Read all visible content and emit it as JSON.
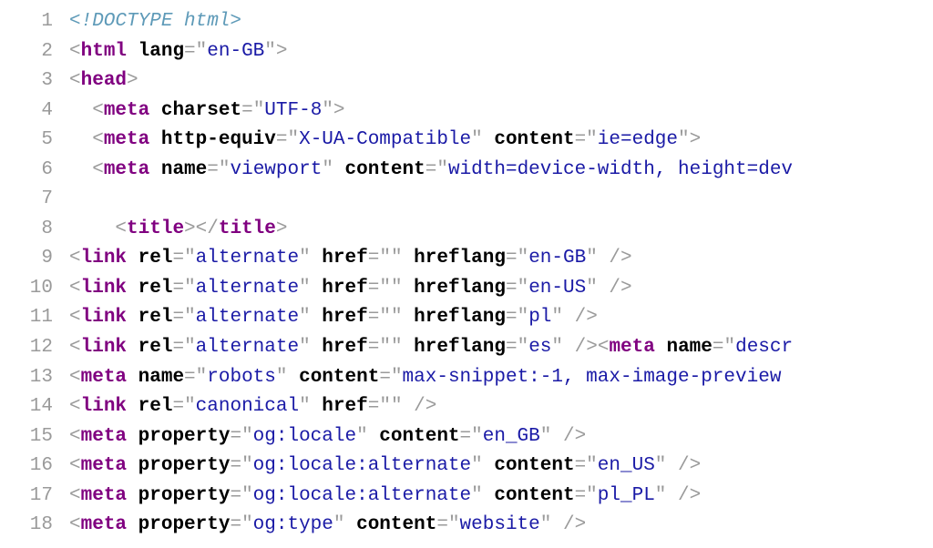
{
  "lines": [
    {
      "n": 1,
      "tokens": [
        [
          "doctype",
          "<!DOCTYPE html>"
        ]
      ]
    },
    {
      "n": 2,
      "tokens": [
        [
          "punct",
          "<"
        ],
        [
          "tag",
          "html"
        ],
        [
          "attr",
          " lang"
        ],
        [
          "punct",
          "="
        ],
        [
          "punct",
          "\""
        ],
        [
          "val",
          "en-GB"
        ],
        [
          "punct",
          "\""
        ],
        [
          "punct",
          ">"
        ]
      ]
    },
    {
      "n": 3,
      "tokens": [
        [
          "punct",
          "<"
        ],
        [
          "tag",
          "head"
        ],
        [
          "punct",
          ">"
        ]
      ]
    },
    {
      "n": 4,
      "tokens": [
        [
          "plain",
          "  "
        ],
        [
          "punct",
          "<"
        ],
        [
          "tag",
          "meta"
        ],
        [
          "attr",
          " charset"
        ],
        [
          "punct",
          "="
        ],
        [
          "punct",
          "\""
        ],
        [
          "val",
          "UTF-8"
        ],
        [
          "punct",
          "\""
        ],
        [
          "punct",
          ">"
        ]
      ]
    },
    {
      "n": 5,
      "tokens": [
        [
          "plain",
          "  "
        ],
        [
          "punct",
          "<"
        ],
        [
          "tag",
          "meta"
        ],
        [
          "attr",
          " http-equiv"
        ],
        [
          "punct",
          "="
        ],
        [
          "punct",
          "\""
        ],
        [
          "val",
          "X-UA-Compatible"
        ],
        [
          "punct",
          "\""
        ],
        [
          "attr",
          " content"
        ],
        [
          "punct",
          "="
        ],
        [
          "punct",
          "\""
        ],
        [
          "val",
          "ie=edge"
        ],
        [
          "punct",
          "\""
        ],
        [
          "punct",
          ">"
        ]
      ]
    },
    {
      "n": 6,
      "tokens": [
        [
          "plain",
          "  "
        ],
        [
          "punct",
          "<"
        ],
        [
          "tag",
          "meta"
        ],
        [
          "attr",
          " name"
        ],
        [
          "punct",
          "="
        ],
        [
          "punct",
          "\""
        ],
        [
          "val",
          "viewport"
        ],
        [
          "punct",
          "\""
        ],
        [
          "attr",
          " content"
        ],
        [
          "punct",
          "="
        ],
        [
          "punct",
          "\""
        ],
        [
          "val",
          "width=device-width, height=dev"
        ]
      ]
    },
    {
      "n": 7,
      "tokens": [
        [
          "plain",
          ""
        ]
      ]
    },
    {
      "n": 8,
      "tokens": [
        [
          "plain",
          "    "
        ],
        [
          "punct",
          "<"
        ],
        [
          "tag",
          "title"
        ],
        [
          "punct",
          ">"
        ],
        [
          "punct",
          "</"
        ],
        [
          "tag",
          "title"
        ],
        [
          "punct",
          ">"
        ]
      ]
    },
    {
      "n": 9,
      "tokens": [
        [
          "punct",
          "<"
        ],
        [
          "tag",
          "link"
        ],
        [
          "attr",
          " rel"
        ],
        [
          "punct",
          "="
        ],
        [
          "punct",
          "\""
        ],
        [
          "val",
          "alternate"
        ],
        [
          "punct",
          "\""
        ],
        [
          "attr",
          " href"
        ],
        [
          "punct",
          "="
        ],
        [
          "punct",
          "\""
        ],
        [
          "punct",
          "\""
        ],
        [
          "attr",
          " hreflang"
        ],
        [
          "punct",
          "="
        ],
        [
          "punct",
          "\""
        ],
        [
          "val",
          "en-GB"
        ],
        [
          "punct",
          "\""
        ],
        [
          "punct",
          " />"
        ]
      ]
    },
    {
      "n": 10,
      "tokens": [
        [
          "punct",
          "<"
        ],
        [
          "tag",
          "link"
        ],
        [
          "attr",
          " rel"
        ],
        [
          "punct",
          "="
        ],
        [
          "punct",
          "\""
        ],
        [
          "val",
          "alternate"
        ],
        [
          "punct",
          "\""
        ],
        [
          "attr",
          " href"
        ],
        [
          "punct",
          "="
        ],
        [
          "punct",
          "\""
        ],
        [
          "punct",
          "\""
        ],
        [
          "attr",
          " hreflang"
        ],
        [
          "punct",
          "="
        ],
        [
          "punct",
          "\""
        ],
        [
          "val",
          "en-US"
        ],
        [
          "punct",
          "\""
        ],
        [
          "punct",
          " />"
        ]
      ]
    },
    {
      "n": 11,
      "tokens": [
        [
          "punct",
          "<"
        ],
        [
          "tag",
          "link"
        ],
        [
          "attr",
          " rel"
        ],
        [
          "punct",
          "="
        ],
        [
          "punct",
          "\""
        ],
        [
          "val",
          "alternate"
        ],
        [
          "punct",
          "\""
        ],
        [
          "attr",
          " href"
        ],
        [
          "punct",
          "="
        ],
        [
          "punct",
          "\""
        ],
        [
          "punct",
          "\""
        ],
        [
          "attr",
          " hreflang"
        ],
        [
          "punct",
          "="
        ],
        [
          "punct",
          "\""
        ],
        [
          "val",
          "pl"
        ],
        [
          "punct",
          "\""
        ],
        [
          "punct",
          " />"
        ]
      ]
    },
    {
      "n": 12,
      "tokens": [
        [
          "punct",
          "<"
        ],
        [
          "tag",
          "link"
        ],
        [
          "attr",
          " rel"
        ],
        [
          "punct",
          "="
        ],
        [
          "punct",
          "\""
        ],
        [
          "val",
          "alternate"
        ],
        [
          "punct",
          "\""
        ],
        [
          "attr",
          " href"
        ],
        [
          "punct",
          "="
        ],
        [
          "punct",
          "\""
        ],
        [
          "punct",
          "\""
        ],
        [
          "attr",
          " hreflang"
        ],
        [
          "punct",
          "="
        ],
        [
          "punct",
          "\""
        ],
        [
          "val",
          "es"
        ],
        [
          "punct",
          "\""
        ],
        [
          "punct",
          " />"
        ],
        [
          "punct",
          "<"
        ],
        [
          "tag",
          "meta"
        ],
        [
          "attr",
          " name"
        ],
        [
          "punct",
          "="
        ],
        [
          "punct",
          "\""
        ],
        [
          "val",
          "descr"
        ]
      ]
    },
    {
      "n": 13,
      "tokens": [
        [
          "punct",
          "<"
        ],
        [
          "tag",
          "meta"
        ],
        [
          "attr",
          " name"
        ],
        [
          "punct",
          "="
        ],
        [
          "punct",
          "\""
        ],
        [
          "val",
          "robots"
        ],
        [
          "punct",
          "\""
        ],
        [
          "attr",
          " content"
        ],
        [
          "punct",
          "="
        ],
        [
          "punct",
          "\""
        ],
        [
          "val",
          "max-snippet:-1, max-image-preview"
        ]
      ]
    },
    {
      "n": 14,
      "tokens": [
        [
          "punct",
          "<"
        ],
        [
          "tag",
          "link"
        ],
        [
          "attr",
          " rel"
        ],
        [
          "punct",
          "="
        ],
        [
          "punct",
          "\""
        ],
        [
          "val",
          "canonical"
        ],
        [
          "punct",
          "\""
        ],
        [
          "attr",
          " href"
        ],
        [
          "punct",
          "="
        ],
        [
          "punct",
          "\""
        ],
        [
          "punct",
          "\""
        ],
        [
          "punct",
          " />"
        ]
      ]
    },
    {
      "n": 15,
      "tokens": [
        [
          "punct",
          "<"
        ],
        [
          "tag",
          "meta"
        ],
        [
          "attr",
          " property"
        ],
        [
          "punct",
          "="
        ],
        [
          "punct",
          "\""
        ],
        [
          "val",
          "og:locale"
        ],
        [
          "punct",
          "\""
        ],
        [
          "attr",
          " content"
        ],
        [
          "punct",
          "="
        ],
        [
          "punct",
          "\""
        ],
        [
          "val",
          "en_GB"
        ],
        [
          "punct",
          "\""
        ],
        [
          "punct",
          " />"
        ]
      ]
    },
    {
      "n": 16,
      "tokens": [
        [
          "punct",
          "<"
        ],
        [
          "tag",
          "meta"
        ],
        [
          "attr",
          " property"
        ],
        [
          "punct",
          "="
        ],
        [
          "punct",
          "\""
        ],
        [
          "val",
          "og:locale:alternate"
        ],
        [
          "punct",
          "\""
        ],
        [
          "attr",
          " content"
        ],
        [
          "punct",
          "="
        ],
        [
          "punct",
          "\""
        ],
        [
          "val",
          "en_US"
        ],
        [
          "punct",
          "\""
        ],
        [
          "punct",
          " />"
        ]
      ]
    },
    {
      "n": 17,
      "tokens": [
        [
          "punct",
          "<"
        ],
        [
          "tag",
          "meta"
        ],
        [
          "attr",
          " property"
        ],
        [
          "punct",
          "="
        ],
        [
          "punct",
          "\""
        ],
        [
          "val",
          "og:locale:alternate"
        ],
        [
          "punct",
          "\""
        ],
        [
          "attr",
          " content"
        ],
        [
          "punct",
          "="
        ],
        [
          "punct",
          "\""
        ],
        [
          "val",
          "pl_PL"
        ],
        [
          "punct",
          "\""
        ],
        [
          "punct",
          " />"
        ]
      ]
    },
    {
      "n": 18,
      "tokens": [
        [
          "punct",
          "<"
        ],
        [
          "tag",
          "meta"
        ],
        [
          "attr",
          " property"
        ],
        [
          "punct",
          "="
        ],
        [
          "punct",
          "\""
        ],
        [
          "val",
          "og:type"
        ],
        [
          "punct",
          "\""
        ],
        [
          "attr",
          " content"
        ],
        [
          "punct",
          "="
        ],
        [
          "punct",
          "\""
        ],
        [
          "val",
          "website"
        ],
        [
          "punct",
          "\""
        ],
        [
          "punct",
          " />"
        ]
      ]
    }
  ]
}
